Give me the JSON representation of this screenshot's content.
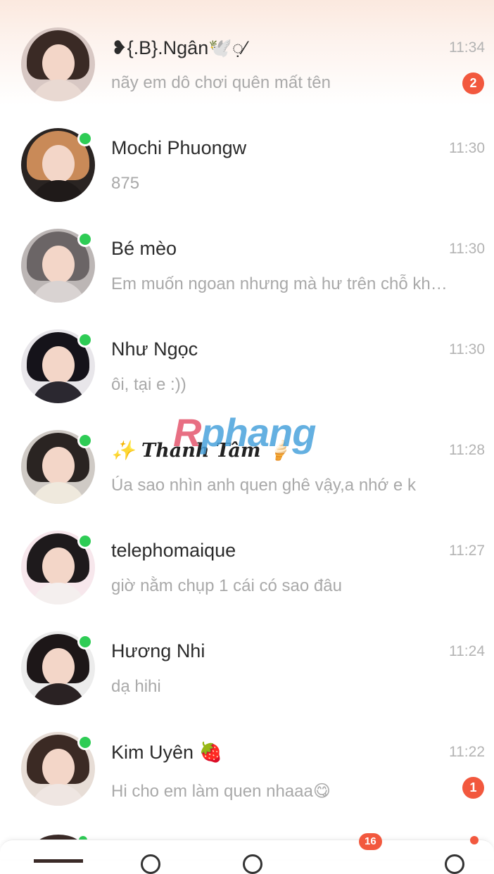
{
  "conversations": [
    {
      "name": "❥{.B}.Ngân🕊️◌̣⁄",
      "time": "11:34",
      "preview": "nãy em dô chơi quên mất  tên",
      "unread": "2",
      "online": false,
      "avatar_colors": {
        "hair": "#3a2a25",
        "body": "#e9d9d2",
        "bg": "#d8c8c4"
      }
    },
    {
      "name": "Mochi Phuongw",
      "time": "11:30",
      "preview": "875",
      "unread": "",
      "online": true,
      "avatar_colors": {
        "hair": "#c98a58",
        "body": "#1f1a19",
        "bg": "#2a2422"
      }
    },
    {
      "name": "Bé mèo",
      "time": "11:30",
      "preview": "Em muốn ngoan nhưng mà hư trên chỗ kh…",
      "unread": "",
      "online": true,
      "avatar_colors": {
        "hair": "#6b6566",
        "body": "#d9d3d2",
        "bg": "#bcb6b5"
      }
    },
    {
      "name": "Như Ngọc",
      "time": "11:30",
      "preview": "ôi, tại e :))",
      "unread": "",
      "online": true,
      "avatar_colors": {
        "hair": "#15131a",
        "body": "#2b2830",
        "bg": "#e8e6ea"
      }
    },
    {
      "name": "✨ Thanh Tâm 🍦",
      "time": "11:28",
      "preview": "Úa sao nhìn anh quen ghê vậy,a nhớ e k",
      "unread": "",
      "online": true,
      "avatar_colors": {
        "hair": "#2a2422",
        "body": "#efe9dd",
        "bg": "#cfcac5"
      }
    },
    {
      "name": "telephomaique",
      "time": "11:27",
      "preview": "giờ nằm chụp 1 cái có sao đâu",
      "unread": "",
      "online": true,
      "avatar_colors": {
        "hair": "#1e1a1c",
        "body": "#f4efee",
        "bg": "#f7e7ec"
      }
    },
    {
      "name": "Hương Nhi",
      "time": "11:24",
      "preview": "dạ hihi",
      "unread": "",
      "online": true,
      "avatar_colors": {
        "hair": "#1d1718",
        "body": "#2a2223",
        "bg": "#ececec"
      }
    },
    {
      "name": "Kim Uyên 🍓",
      "time": "11:22",
      "preview": "Hi cho em làm quen nhaaa😋",
      "unread": "1",
      "online": true,
      "avatar_colors": {
        "hair": "#3b2a24",
        "body": "#efe6e2",
        "bg": "#e7ddd6"
      }
    }
  ],
  "watermark": {
    "r": "R",
    "rest": "phang"
  },
  "bottom_nav": {
    "badge": "16"
  },
  "colors": {
    "accent": "#f2583e",
    "online": "#2ecc55",
    "time": "#b3b3b3",
    "preview": "#a9a9a9"
  }
}
